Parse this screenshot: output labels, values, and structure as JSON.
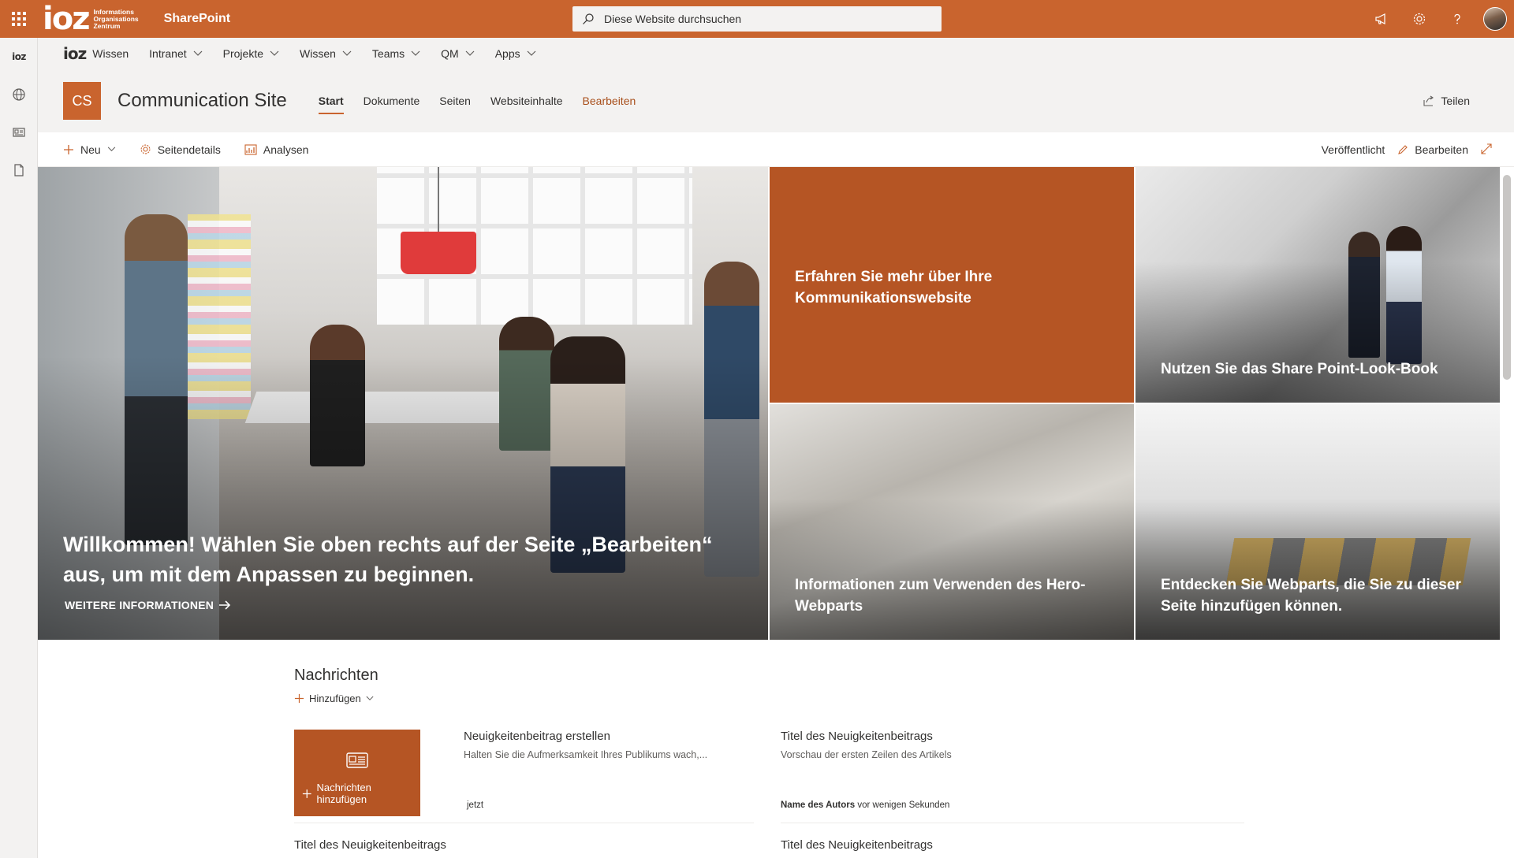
{
  "suite": {
    "logo_mark": "ioz",
    "logo_text": [
      "Informations",
      "Organisations",
      "Zentrum"
    ],
    "app_name": "SharePoint",
    "search_placeholder": "Diese Website durchsuchen"
  },
  "appbar": {
    "logo": "ioz"
  },
  "hubnav": {
    "logo_mark": "ioz",
    "logo_label": "Wissen",
    "items": [
      "Intranet",
      "Projekte",
      "Wissen",
      "Teams",
      "QM",
      "Apps"
    ]
  },
  "site": {
    "initials": "CS",
    "title": "Communication Site",
    "nav": [
      "Start",
      "Dokumente",
      "Seiten",
      "Websiteinhalte",
      "Bearbeiten"
    ],
    "share": "Teilen"
  },
  "commandbar": {
    "new": "Neu",
    "page_details": "Seitendetails",
    "analytics": "Analysen",
    "status": "Veröffentlicht",
    "edit": "Bearbeiten"
  },
  "hero": {
    "main_title": "Willkommen! Wählen Sie oben rechts auf der Seite „Bearbeiten“ aus, um mit dem Anpassen zu beginnen.",
    "main_link": "WEITERE INFORMATIONEN",
    "tile1": "Erfahren Sie mehr über Ihre Kommunikationswebsite",
    "tile2": "Nutzen Sie das Share Point-Look-Book",
    "tile3": "Informationen zum Verwenden des Hero-Webparts",
    "tile4": "Entdecken Sie Webparts, die Sie zu dieser Seite hinzufügen können."
  },
  "news": {
    "heading": "Nachrichten",
    "add": "Hinzufügen",
    "tile_label": "Nachrichten hinzufügen",
    "card1": {
      "title": "Neuigkeitenbeitrag erstellen",
      "desc": "Halten Sie die Aufmerksamkeit Ihres Publikums wach,...",
      "time": "jetzt"
    },
    "card2": {
      "title": "Titel des Neuigkeitenbeitrags",
      "desc": "Vorschau der ersten Zeilen des Artikels",
      "author": "Name des Autors",
      "time": "vor wenigen Sekunden"
    },
    "next_left": "Titel des Neuigkeitenbeitrags",
    "next_right": "Titel des Neuigkeitenbeitrags"
  },
  "colors": {
    "brand": "#c9642e",
    "tile_orange": "#b55524"
  }
}
